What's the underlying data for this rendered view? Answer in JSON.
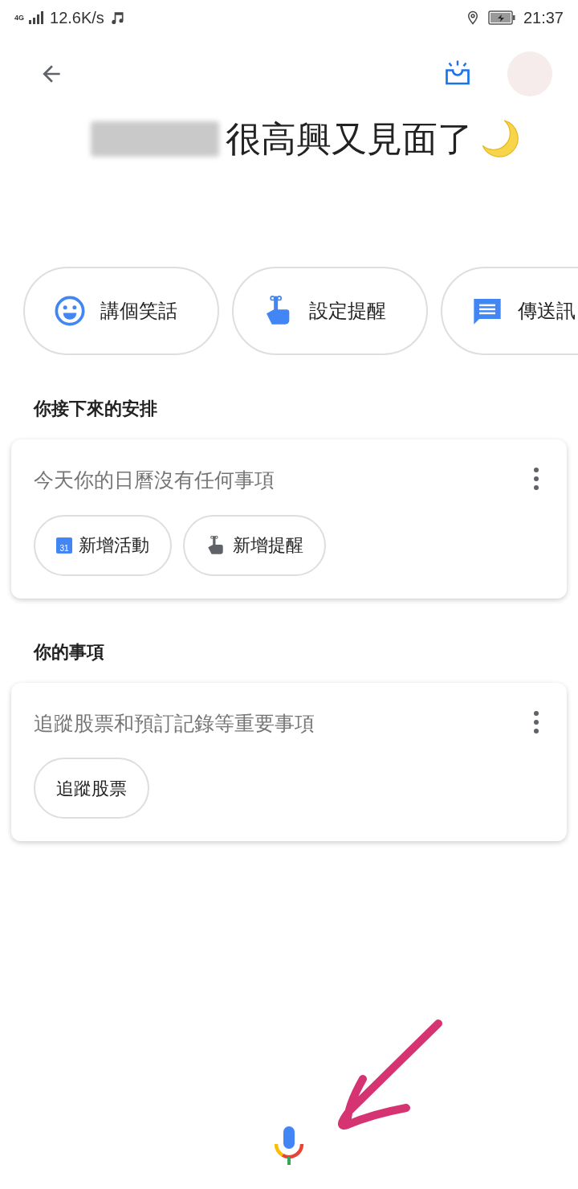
{
  "status_bar": {
    "network": "4G",
    "speed": "12.6K/s",
    "time": "21:37"
  },
  "greeting": {
    "text": "很高興又見面了"
  },
  "suggestions": [
    {
      "kind": "smile",
      "label": "講個笑話"
    },
    {
      "kind": "reminder",
      "label": "設定提醒"
    },
    {
      "kind": "message",
      "label": "傳送訊"
    }
  ],
  "sections": [
    {
      "title": "你接下來的安排",
      "card": {
        "message": "今天你的日曆沒有任何事項",
        "actions": [
          {
            "kind": "calendar",
            "label": "新增活動",
            "icon_text": "31"
          },
          {
            "kind": "reminder",
            "label": "新增提醒"
          }
        ]
      }
    },
    {
      "title": "你的事項",
      "card": {
        "message": "追蹤股票和預訂記錄等重要事項",
        "actions": [
          {
            "kind": "plain",
            "label": "追蹤股票"
          }
        ]
      }
    }
  ]
}
